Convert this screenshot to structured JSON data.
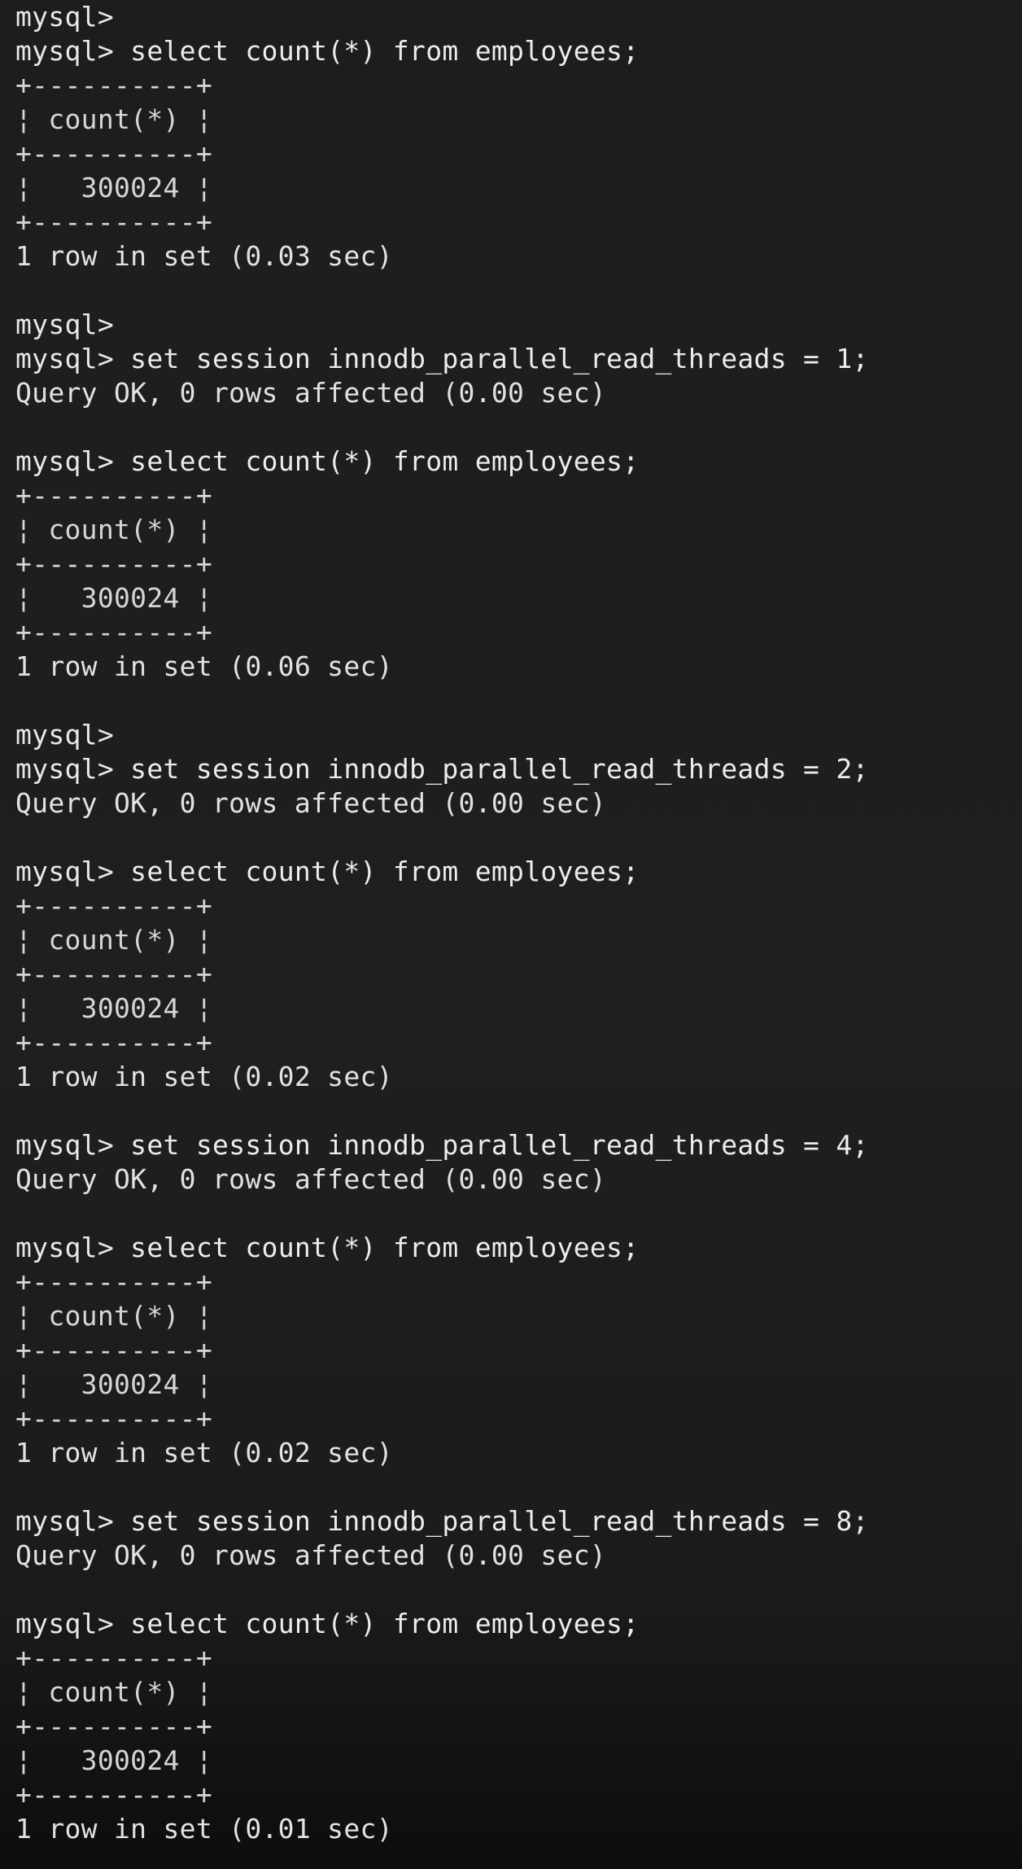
{
  "terminal": {
    "prompt": "mysql>",
    "lines": [
      {
        "kind": "prompt",
        "cmd": ""
      },
      {
        "kind": "prompt",
        "cmd": "select count(*) from employees;"
      },
      {
        "kind": "box",
        "text": "+----------+"
      },
      {
        "kind": "box",
        "text": "¦ count(*) ¦"
      },
      {
        "kind": "box",
        "text": "+----------+"
      },
      {
        "kind": "box",
        "text": "¦   300024 ¦"
      },
      {
        "kind": "box",
        "text": "+----------+"
      },
      {
        "kind": "result",
        "text": "1 row in set (0.03 sec)"
      },
      {
        "kind": "blank",
        "text": ""
      },
      {
        "kind": "prompt",
        "cmd": ""
      },
      {
        "kind": "prompt",
        "cmd": "set session innodb_parallel_read_threads = 1;"
      },
      {
        "kind": "result",
        "text": "Query OK, 0 rows affected (0.00 sec)"
      },
      {
        "kind": "blank",
        "text": ""
      },
      {
        "kind": "prompt",
        "cmd": "select count(*) from employees;"
      },
      {
        "kind": "box",
        "text": "+----------+"
      },
      {
        "kind": "box",
        "text": "¦ count(*) ¦"
      },
      {
        "kind": "box",
        "text": "+----------+"
      },
      {
        "kind": "box",
        "text": "¦   300024 ¦"
      },
      {
        "kind": "box",
        "text": "+----------+"
      },
      {
        "kind": "result",
        "text": "1 row in set (0.06 sec)"
      },
      {
        "kind": "blank",
        "text": ""
      },
      {
        "kind": "prompt",
        "cmd": ""
      },
      {
        "kind": "prompt",
        "cmd": "set session innodb_parallel_read_threads = 2;"
      },
      {
        "kind": "result",
        "text": "Query OK, 0 rows affected (0.00 sec)"
      },
      {
        "kind": "blank",
        "text": ""
      },
      {
        "kind": "prompt",
        "cmd": "select count(*) from employees;"
      },
      {
        "kind": "box",
        "text": "+----------+"
      },
      {
        "kind": "box",
        "text": "¦ count(*) ¦"
      },
      {
        "kind": "box",
        "text": "+----------+"
      },
      {
        "kind": "box",
        "text": "¦   300024 ¦"
      },
      {
        "kind": "box",
        "text": "+----------+"
      },
      {
        "kind": "result",
        "text": "1 row in set (0.02 sec)"
      },
      {
        "kind": "blank",
        "text": ""
      },
      {
        "kind": "prompt",
        "cmd": "set session innodb_parallel_read_threads = 4;"
      },
      {
        "kind": "result",
        "text": "Query OK, 0 rows affected (0.00 sec)"
      },
      {
        "kind": "blank",
        "text": ""
      },
      {
        "kind": "prompt",
        "cmd": "select count(*) from employees;"
      },
      {
        "kind": "box",
        "text": "+----------+"
      },
      {
        "kind": "box",
        "text": "¦ count(*) ¦"
      },
      {
        "kind": "box",
        "text": "+----------+"
      },
      {
        "kind": "box",
        "text": "¦   300024 ¦"
      },
      {
        "kind": "box",
        "text": "+----------+"
      },
      {
        "kind": "result",
        "text": "1 row in set (0.02 sec)"
      },
      {
        "kind": "blank",
        "text": ""
      },
      {
        "kind": "prompt",
        "cmd": "set session innodb_parallel_read_threads = 8;"
      },
      {
        "kind": "result",
        "text": "Query OK, 0 rows affected (0.00 sec)"
      },
      {
        "kind": "blank",
        "text": ""
      },
      {
        "kind": "prompt",
        "cmd": "select count(*) from employees;"
      },
      {
        "kind": "box",
        "text": "+----------+"
      },
      {
        "kind": "box",
        "text": "¦ count(*) ¦"
      },
      {
        "kind": "box",
        "text": "+----------+"
      },
      {
        "kind": "box",
        "text": "¦   300024 ¦"
      },
      {
        "kind": "box",
        "text": "+----------+"
      },
      {
        "kind": "result",
        "text": "1 row in set (0.01 sec)"
      }
    ]
  },
  "colors": {
    "background": "#1e1e1e",
    "foreground": "#e6e6e6"
  }
}
